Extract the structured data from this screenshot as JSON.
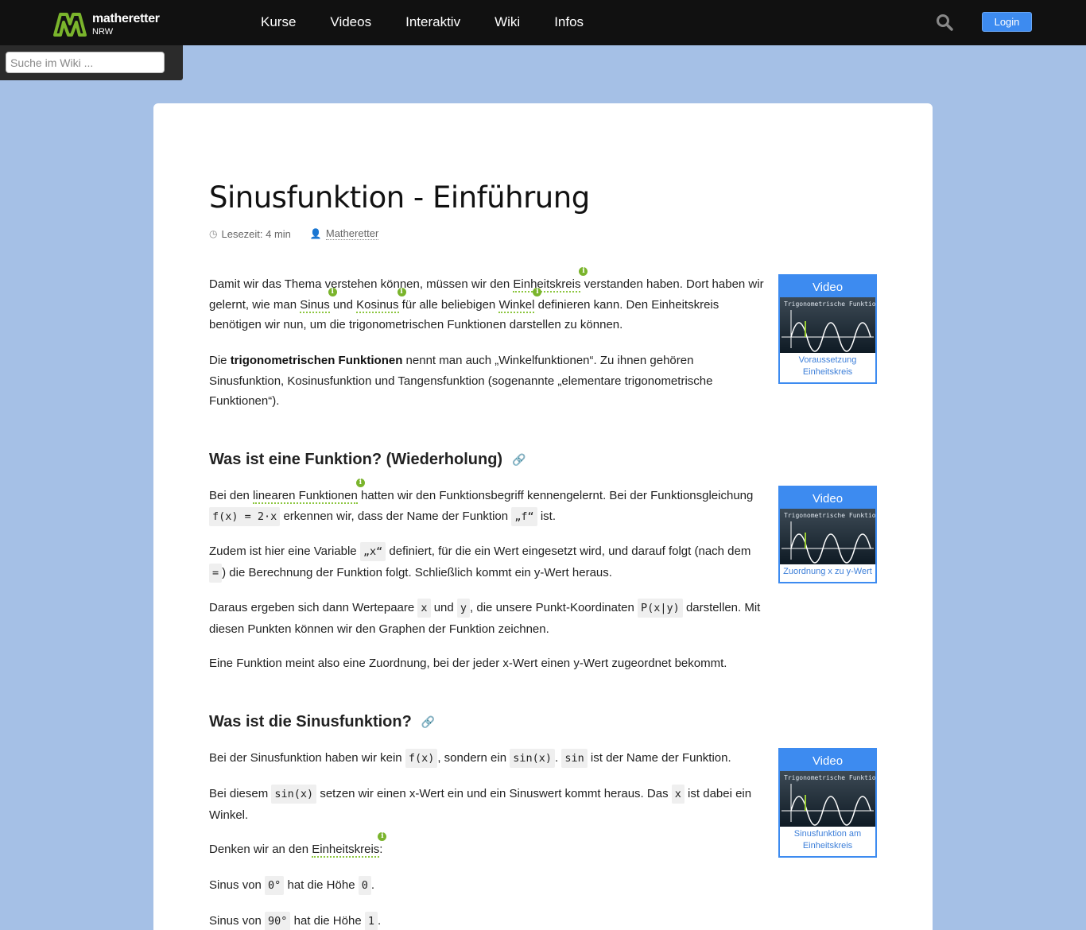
{
  "header": {
    "brand": "matheretter",
    "region": "NRW",
    "nav": [
      "Kurse",
      "Videos",
      "Interaktiv",
      "Wiki",
      "Infos"
    ],
    "login_label": "Login",
    "search_icon": "search-icon"
  },
  "wiki_search": {
    "placeholder": "Suche im Wiki ..."
  },
  "colors": {
    "accent": "#3d8bf0",
    "background": "#a5c0e6",
    "topbar": "#111111",
    "tooltip": "#8cc63f"
  },
  "article": {
    "title": "Sinusfunktion - Einführung",
    "reading_time": "Lesezeit: 4 min",
    "author": "Matheretter",
    "intro1": {
      "a": "Damit wir das Thema verstehen können, müssen wir den ",
      "link1": "Einheitskreis",
      "b": " verstanden haben. Dort haben wir gelernt, wie man ",
      "link2": "Sinus",
      "c": " und ",
      "link3": "Kosinus",
      "d": " für alle beliebigen ",
      "link4": "Winkel",
      "e": " definieren kann. Den Einheitskreis benötigen wir nun, um die trigonometrischen Funktionen darstellen zu können."
    },
    "intro2": {
      "a": "Die ",
      "bold": "trigonometrischen Funktionen",
      "b": " nennt man auch „Winkelfunktionen“. Zu ihnen gehören Sinusfunktion, Kosinusfunktion und Tangensfunktion (sogenannte „elementare trigonometrische Funktionen“)."
    },
    "section1": {
      "heading": "Was ist eine Funktion? (Wiederholung)",
      "p1": {
        "a": "Bei den ",
        "link": "linearen Funktionen",
        "b": " hatten wir den Funktionsbegriff kennengelernt. Bei der Funktionsgleichung ",
        "code1": "f(x) = 2·x",
        "c": " erkennen wir, dass der Name der Funktion ",
        "code2": "„f“",
        "d": " ist."
      },
      "p2": {
        "a": "Zudem ist hier eine Variable ",
        "code1": "„x“",
        "b": " definiert, für die ein Wert eingesetzt wird, und darauf folgt (nach dem ",
        "code2": "=",
        "c": ") die Berechnung der Funktion folgt. Schließlich kommt ein y-Wert heraus."
      },
      "p3": {
        "a": "Daraus ergeben sich dann Wertepaare ",
        "code1": "x",
        "b": " und ",
        "code2": "y",
        "c": ", die unsere Punkt-Koordinaten ",
        "code3": "P(x|y)",
        "d": " darstellen. Mit diesen Punkten können wir den Graphen der Funktion zeichnen."
      },
      "p4": "Eine Funktion meint also eine Zuordnung, bei der jeder x-Wert einen y-Wert zugeordnet bekommt."
    },
    "section2": {
      "heading": "Was ist die Sinusfunktion?",
      "p1": {
        "a": "Bei der Sinusfunktion haben wir kein ",
        "code1": "f(x)",
        "b": ", sondern ein ",
        "code2": "sin(x)",
        "c": ". ",
        "code3": "sin",
        "d": " ist der Name der Funktion."
      },
      "p2": {
        "a": "Bei diesem ",
        "code1": "sin(x)",
        "b": " setzen wir einen x-Wert ein und ein Sinuswert kommt heraus. Das ",
        "code2": "x",
        "c": " ist dabei ein Winkel."
      },
      "p3": {
        "a": "Denken wir an den ",
        "link": "Einheitskreis",
        "b": ":"
      },
      "p4": {
        "a": "Sinus von ",
        "code1": "0°",
        "b": " hat die Höhe ",
        "code2": "0",
        "c": "."
      },
      "p5": {
        "a": "Sinus von ",
        "code1": "90°",
        "b": " hat die Höhe ",
        "code2": "1",
        "c": "."
      }
    }
  },
  "videos": [
    {
      "label": "Video",
      "thumb_title": "Trigonometrische Funktionen",
      "caption": "Voraussetzung Einheitskreis"
    },
    {
      "label": "Video",
      "thumb_title": "Trigonometrische Funktionen",
      "caption": "Zuordnung x zu y-Wert"
    },
    {
      "label": "Video",
      "thumb_title": "Trigonometrische Funktionen",
      "caption": "Sinusfunktion am Einheitskreis"
    }
  ]
}
